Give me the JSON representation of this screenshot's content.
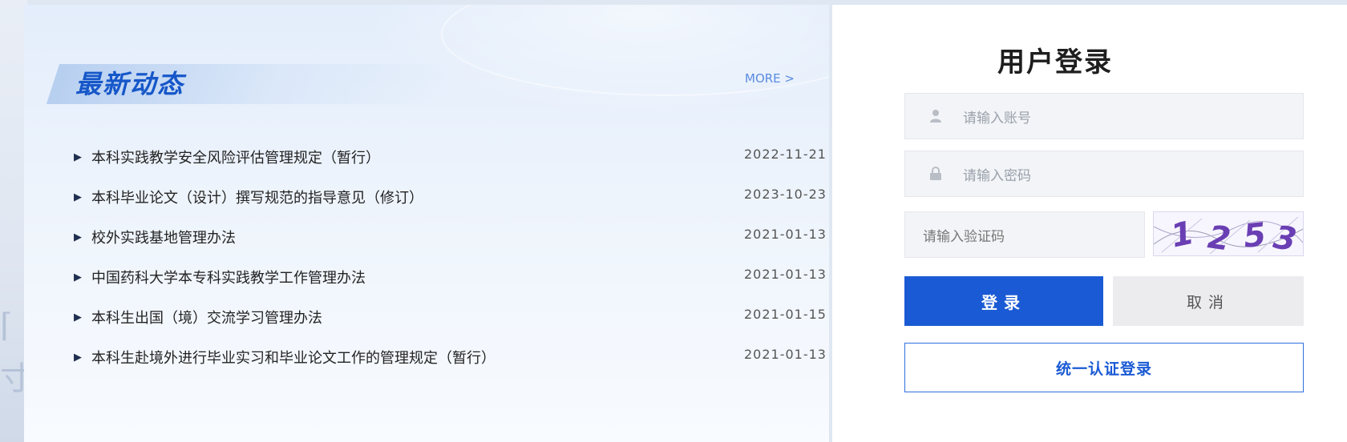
{
  "background": {
    "glyphs": [
      "⌈",
      "⌐",
      "寸"
    ]
  },
  "news": {
    "title": "最新动态",
    "more_label": "MORE >",
    "items": [
      {
        "bullet": "▶",
        "text": "本科实践教学安全风险评估管理规定（暂行）",
        "date": "2022-11-21"
      },
      {
        "bullet": "▶",
        "text": "本科毕业论文（设计）撰写规范的指导意见（修订）",
        "date": "2023-10-23"
      },
      {
        "bullet": "▶",
        "text": "校外实践基地管理办法",
        "date": "2021-01-13"
      },
      {
        "bullet": "▶",
        "text": "中国药科大学本专科实践教学工作管理办法",
        "date": "2021-01-13"
      },
      {
        "bullet": "▶",
        "text": "本科生出国（境）交流学习管理办法",
        "date": "2021-01-15"
      },
      {
        "bullet": "▶",
        "text": "本科生赴境外进行毕业实习和毕业论文工作的管理规定（暂行）",
        "date": "2021-01-13"
      }
    ]
  },
  "login": {
    "title": "用户登录",
    "account_placeholder": "请输入账号",
    "password_placeholder": "请输入密码",
    "captcha_placeholder": "请输入验证码",
    "captcha_code": "1253",
    "login_label": "登录",
    "cancel_label": "取消",
    "sso_label": "统一认证登录"
  },
  "colors": {
    "accent": "#1a5ad4",
    "title_blue": "#1657c9",
    "captcha_text": "#6a3fb3"
  },
  "icons": {
    "account": "user-icon",
    "password": "lock-icon",
    "more": "chevron-right-icon"
  }
}
